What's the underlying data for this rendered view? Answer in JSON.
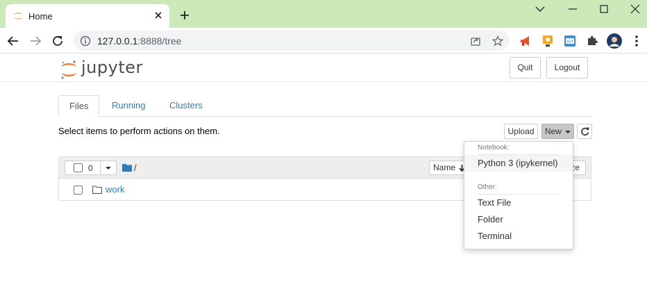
{
  "browser": {
    "tab_title": "Home",
    "url_host": "127.0.0.1",
    "url_rest": ":8888/tree",
    "icons": [
      "jupyter-favicon",
      "close-icon",
      "plus-icon",
      "chevron-down-icon",
      "minimize-icon",
      "maximize-icon",
      "window-close-icon",
      "back-arrow-icon",
      "forward-arrow-icon",
      "reload-icon",
      "info-icon",
      "share-icon",
      "star-icon",
      "megaphone-extension-icon",
      "speaker-extension-icon",
      "translate-extension-icon",
      "puzzle-icon",
      "profile-avatar",
      "kebab-menu-icon"
    ]
  },
  "header": {
    "logo_text": "jupyter",
    "quit_label": "Quit",
    "logout_label": "Logout"
  },
  "tabs": [
    {
      "label": "Files",
      "active": true
    },
    {
      "label": "Running",
      "active": false
    },
    {
      "label": "Clusters",
      "active": false
    }
  ],
  "toolbar": {
    "select_message": "Select items to perform actions on them.",
    "upload_label": "Upload",
    "new_label": "New"
  },
  "list": {
    "selected_count": "0",
    "breadcrumb": "/",
    "name_sort_label": "Name",
    "size_label": "ze",
    "rows": [
      {
        "name": "work"
      }
    ]
  },
  "new_menu": {
    "notebook_header": "Notebook:",
    "python_kernel": "Python 3 (ipykernel)",
    "other_header": "Other:",
    "text_file": "Text File",
    "folder": "Folder",
    "terminal": "Terminal"
  },
  "colors": {
    "tabstrip": "#cde8b9",
    "link": "#337ab7",
    "jupyter_orange": "#f37726"
  }
}
